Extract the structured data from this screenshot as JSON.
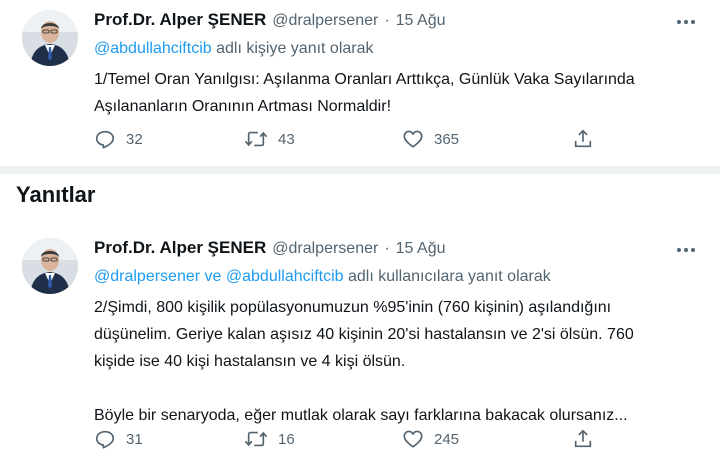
{
  "tweets": [
    {
      "display_name": "Prof.Dr. Alper ŞENER",
      "handle": "@dralpersener",
      "separator": "·",
      "time": "15 Ağu",
      "reply_to": {
        "mentions": [
          "@abdullahciftcib"
        ],
        "joiner": "",
        "suffix": "adlı kişiye yanıt olarak"
      },
      "text_lines": [
        "1/Temel Oran Yanılgısı: Aşılanma Oranları Arttıkça, Günlük Vaka Sayılarında",
        "Aşılananların Oranının Artması Normaldir!"
      ],
      "replies": "32",
      "retweets": "43",
      "likes": "365"
    },
    {
      "display_name": "Prof.Dr. Alper ŞENER",
      "handle": "@dralpersener",
      "separator": "·",
      "time": "15 Ağu",
      "reply_to": {
        "mentions": [
          "@dralpersener",
          "@abdullahciftcib"
        ],
        "joiner": "ve",
        "suffix": "adlı kullanıcılara yanıt olarak"
      },
      "text_lines": [
        "2/Şimdi, 800 kişilik popülasyonumuzun %95'inin (760 kişinin) aşılandığını",
        "düşünelim. Geriye kalan aşısız 40 kişinin 20'si hastalansın ve 2'si ölsün. 760",
        "kişide ise 40 kişi hastalansın ve 4 kişi ölsün.",
        "",
        "Böyle bir senaryoda, eğer mutlak olarak sayı farklarına bakacak olursanız..."
      ],
      "replies": "31",
      "retweets": "16",
      "likes": "245"
    }
  ],
  "section_title": "Yanıtlar",
  "icons": {
    "reply": "reply-bubble-icon",
    "retweet": "retweet-arrows-icon",
    "like": "heart-icon",
    "share": "share-upload-icon",
    "more": "three-dots-icon"
  },
  "colors": {
    "link": "#1d9bf0",
    "secondary_text": "#536471",
    "primary_text": "#0f1419",
    "divider": "#eff3f4"
  }
}
